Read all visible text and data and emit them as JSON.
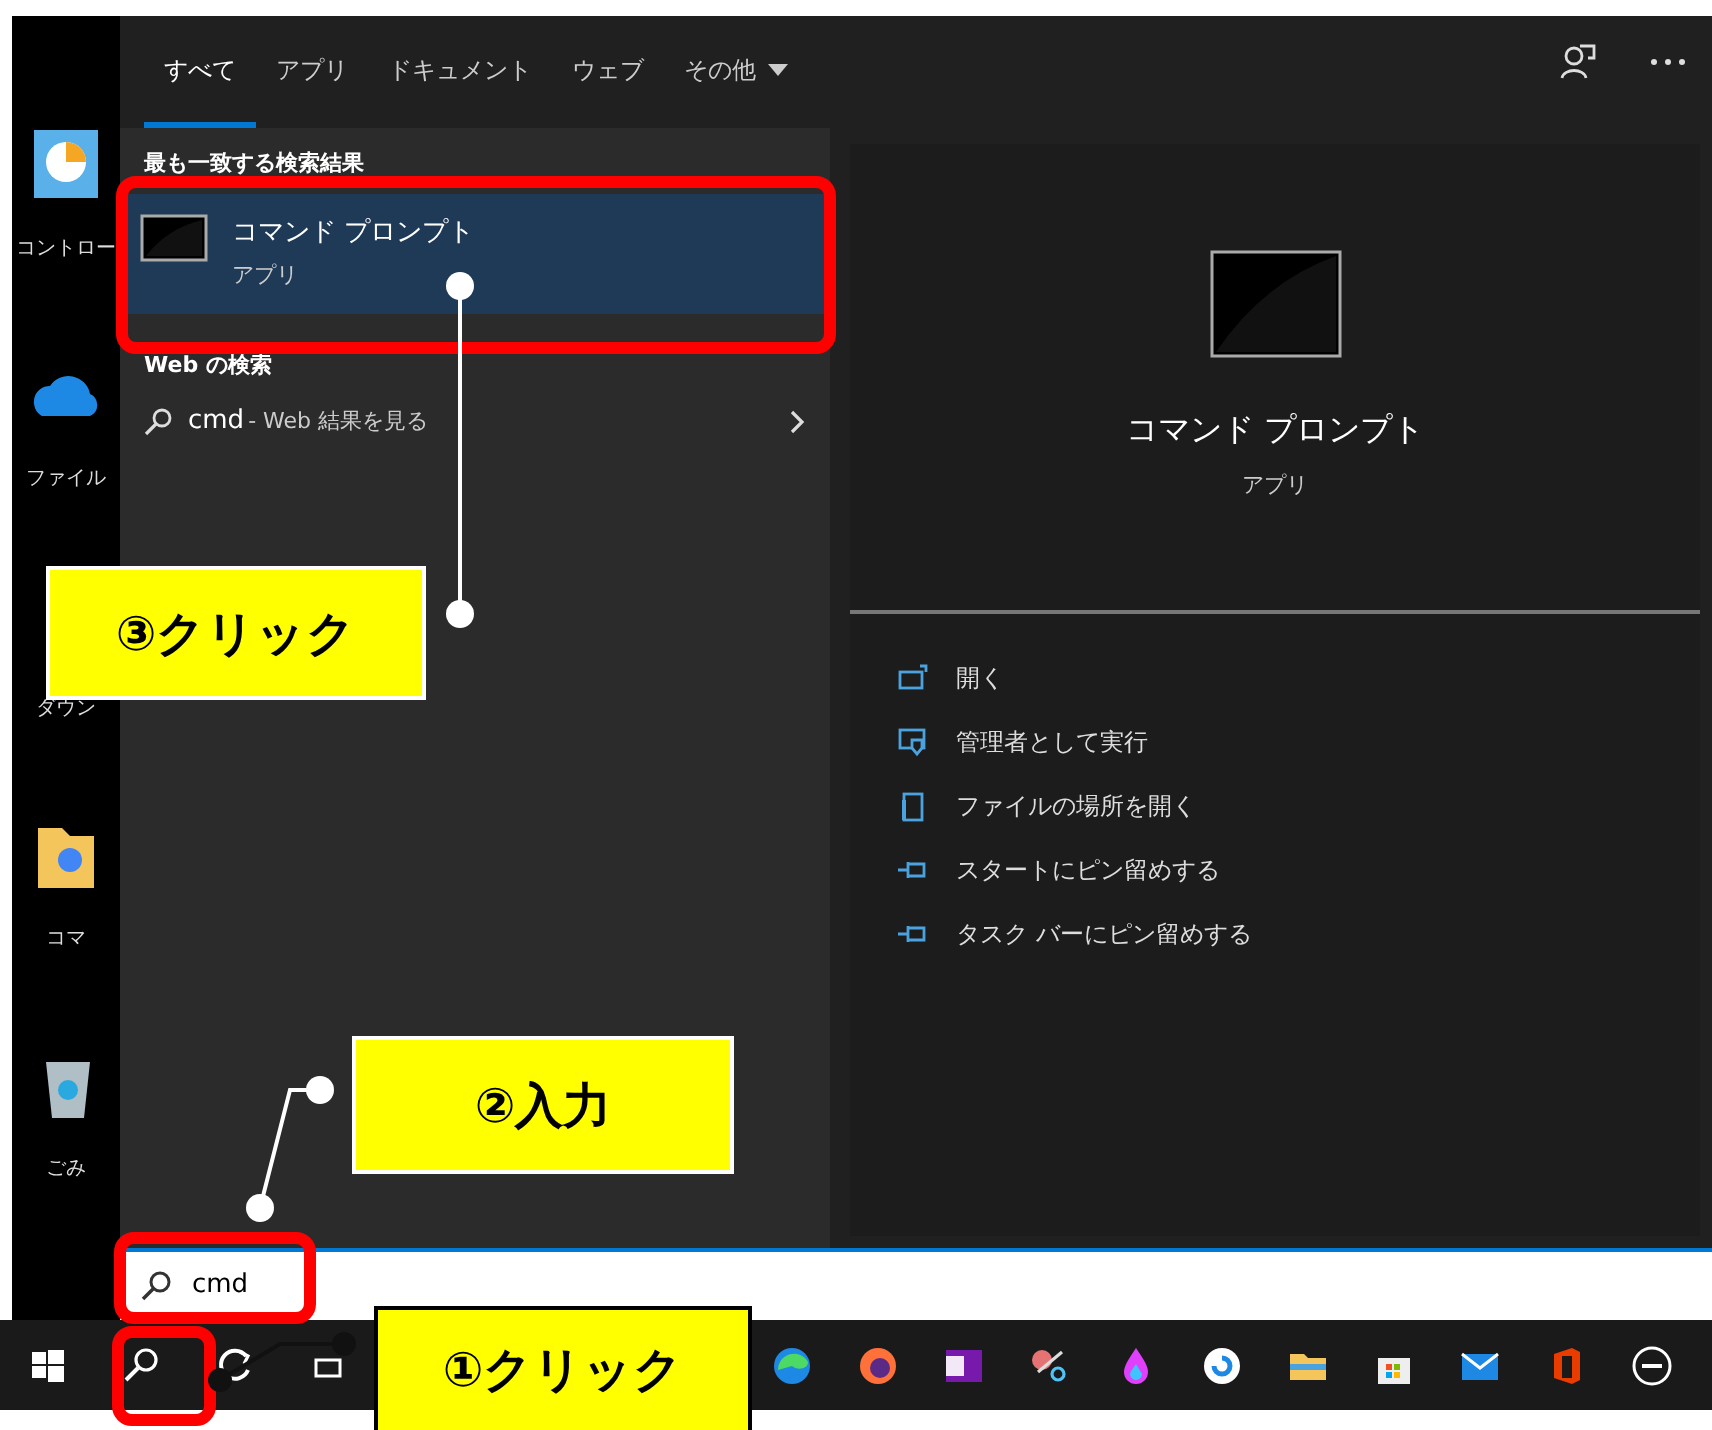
{
  "desktop_icons": [
    {
      "label": "コントロー",
      "kind": "control"
    },
    {
      "label": "ファイル",
      "kind": "cloud"
    },
    {
      "label": "ダウン",
      "kind": "blank"
    },
    {
      "label": "コマ",
      "kind": "folder"
    },
    {
      "label": "ごみ",
      "kind": "bin"
    }
  ],
  "tabs": [
    {
      "label": "すべて",
      "selected": true,
      "dropdown": false
    },
    {
      "label": "アプリ",
      "selected": false,
      "dropdown": false
    },
    {
      "label": "ドキュメント",
      "selected": false,
      "dropdown": false
    },
    {
      "label": "ウェブ",
      "selected": false,
      "dropdown": false
    },
    {
      "label": "その他",
      "selected": false,
      "dropdown": true
    }
  ],
  "best_match": {
    "heading": "最も一致する検索結果",
    "title": "コマンド プロンプト",
    "subtitle": "アプリ",
    "selected": true
  },
  "web_search": {
    "heading": "Web の検索",
    "query": "cmd",
    "suffix": " - Web 結果を見る"
  },
  "detail": {
    "title": "コマンド プロンプト",
    "subtitle": "アプリ",
    "actions": [
      {
        "label": "開く",
        "kind": "open"
      },
      {
        "label": "管理者として実行",
        "kind": "admin"
      },
      {
        "label": "ファイルの場所を開く",
        "kind": "folder"
      },
      {
        "label": "スタートにピン留めする",
        "kind": "pin"
      },
      {
        "label": "タスク バーにピン留めする",
        "kind": "pin"
      }
    ]
  },
  "search_box": {
    "value": "cmd"
  },
  "callouts": [
    {
      "label": "③クリック",
      "kind": "result"
    },
    {
      "label": "②入力",
      "kind": "input"
    },
    {
      "label": "①クリック",
      "kind": "taskbar"
    }
  ]
}
